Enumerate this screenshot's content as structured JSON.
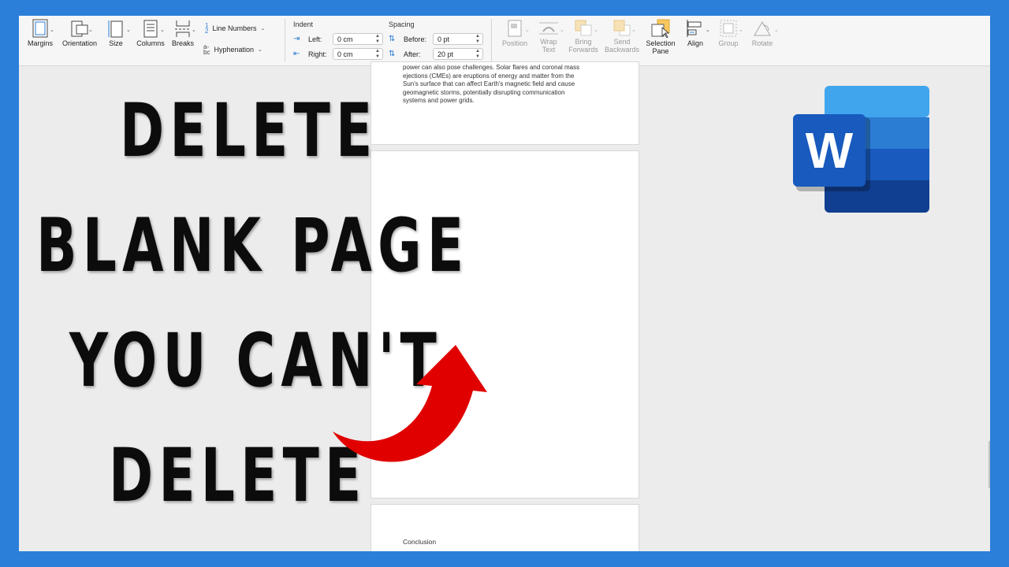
{
  "ribbon": {
    "page_setup": {
      "margins": "Margins",
      "orientation": "Orientation",
      "size": "Size",
      "columns": "Columns",
      "breaks": "Breaks",
      "line_numbers": "Line Numbers",
      "hyphenation": "Hyphenation"
    },
    "paragraph": {
      "indent_title": "Indent",
      "left_label": "Left:",
      "left_value": "0 cm",
      "right_label": "Right:",
      "right_value": "0 cm",
      "spacing_title": "Spacing",
      "before_label": "Before:",
      "before_value": "0 pt",
      "after_label": "After:",
      "after_value": "20 pt"
    },
    "arrange": {
      "position": "Position",
      "wrap_text_1": "Wrap",
      "wrap_text_2": "Text",
      "bring_forwards_1": "Bring",
      "bring_forwards_2": "Forwards",
      "send_backwards_1": "Send",
      "send_backwards_2": "Backwards",
      "selection_pane_1": "Selection",
      "selection_pane_2": "Pane",
      "align": "Align",
      "group": "Group",
      "rotate": "Rotate"
    }
  },
  "document": {
    "page1_lines": [
      "power can also pose challenges. Solar flares and coronal mass",
      "ejections (CMEs) are eruptions of energy and matter from the",
      "Sun's surface that can affect Earth's magnetic field and cause",
      "geomagnetic storms, potentially disrupting communication",
      "systems and power grids."
    ],
    "page3_heading": "Conclusion"
  },
  "overlay": {
    "line1": "DELETE",
    "line2": "BLANK PAGE",
    "line3": "YOU CAN'T",
    "line4": "DELETE",
    "arrow_color": "#e00000"
  },
  "logo": {
    "letter": "W",
    "colors": [
      "#41a5ee",
      "#2b7cd3",
      "#185abd",
      "#103f91"
    ]
  }
}
